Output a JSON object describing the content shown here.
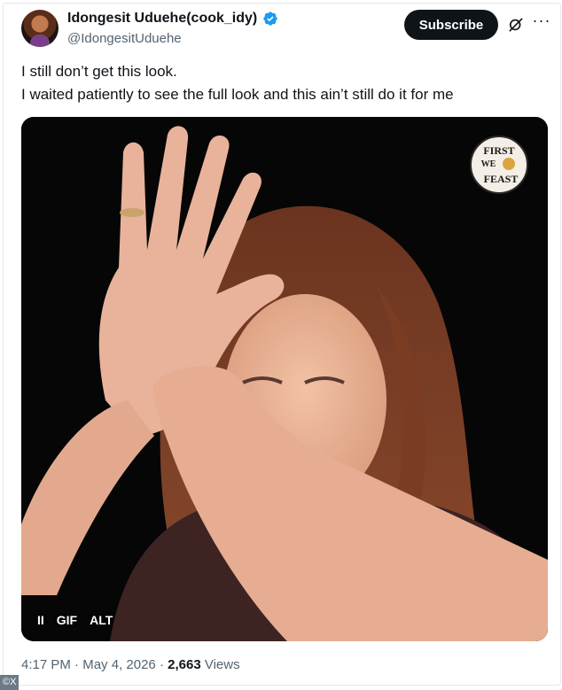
{
  "author": {
    "display_name": "Idongesit Uduehe(cook_idy)",
    "handle": "@IdongesitUduehe",
    "verified": true
  },
  "header": {
    "subscribe_label": "Subscribe",
    "grok_icon": "grok-icon",
    "more_icon": "more-horizontal-icon"
  },
  "tweet": {
    "line1": "I still don’t get this look.",
    "line2": "I waited patiently to see the full look and this ain’t still do it for me"
  },
  "media": {
    "type": "GIF",
    "logo_text": [
      "FIRST",
      "WE",
      "FEAST"
    ],
    "controls": {
      "pause": "II",
      "gif": "GIF",
      "alt": "ALT"
    }
  },
  "meta": {
    "time": "4:17 PM",
    "sep1": " · ",
    "date": "May 4, 2026",
    "sep2": " · ",
    "views_count": "2,663",
    "views_label": " Views"
  },
  "credit": "©X",
  "colors": {
    "accent": "#1d9bf0",
    "button_bg": "#0f1419",
    "secondary_text": "#536471"
  }
}
